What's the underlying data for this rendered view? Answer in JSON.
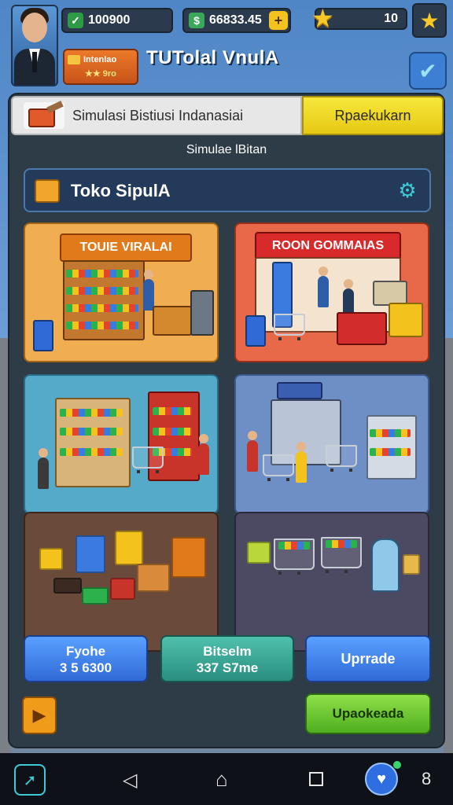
{
  "hud": {
    "cash_value": "100900",
    "cash_icon": "cash-icon",
    "money_value": "66833.45",
    "money_icon": "banknote-icon",
    "plus_label": "+",
    "stars_value": "10",
    "star_icon": "star-icon"
  },
  "badge": {
    "line1": "Intenlao",
    "line2": "★★ 9ro"
  },
  "title": "TUTolal VnulA",
  "check_symbol": "✔",
  "tabs": {
    "main_label": "Simulasi Bistiusi Indanasiai",
    "action_label": "Rpaekukarn"
  },
  "subtitle": "Simulae lBitan",
  "store_section": {
    "label": "Toko SipulA",
    "gear_symbol": "⚙"
  },
  "cards": {
    "card1_sign": "TOUIE VIRALAI",
    "card2_sign": "ROON GOMMAIAS"
  },
  "buttons": {
    "b1_line1": "Fyohe",
    "b1_line2": "3 5 6300",
    "b2_line1": "Bitselm",
    "b2_line2": "337 S7me",
    "b3_label": "Uprrade",
    "green_label": "Upaokeada",
    "play_symbol": "▶"
  },
  "nav": {
    "left_symbol": "➚",
    "back_symbol": "◁",
    "home_symbol": "⌂",
    "shield_symbol": "♥",
    "more_symbol": "8"
  },
  "colors": {
    "accent_yellow": "#e6c914",
    "accent_blue": "#2f6ad6",
    "accent_green": "#4fae1f",
    "panel": "#2e3c48"
  }
}
